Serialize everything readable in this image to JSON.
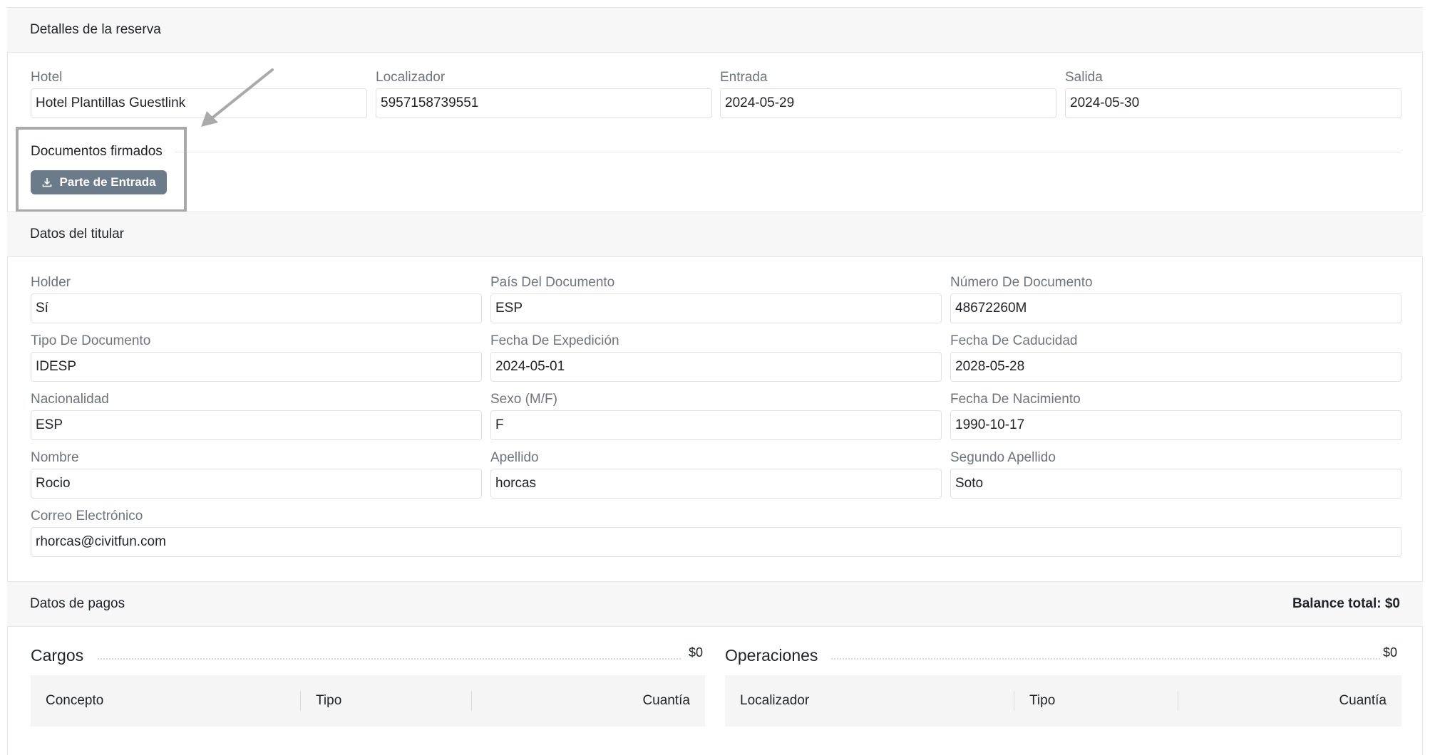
{
  "reservation": {
    "section_title": "Detalles de la reserva",
    "fields": [
      {
        "label": "Hotel",
        "value": "Hotel Plantillas Guestlink"
      },
      {
        "label": "Localizador",
        "value": "5957158739551"
      },
      {
        "label": "Entrada",
        "value": "2024-05-29"
      },
      {
        "label": "Salida",
        "value": "2024-05-30"
      }
    ],
    "signed_docs_label": "Documentos firmados",
    "download_button_label": "Parte de Entrada"
  },
  "holder": {
    "section_title": "Datos del titular",
    "fields": [
      {
        "label": "Holder",
        "value": "Sí"
      },
      {
        "label": "País Del Documento",
        "value": "ESP"
      },
      {
        "label": "Número De Documento",
        "value": "48672260M"
      },
      {
        "label": "Tipo De Documento",
        "value": "IDESP"
      },
      {
        "label": "Fecha De Expedición",
        "value": "2024-05-01"
      },
      {
        "label": "Fecha De Caducidad",
        "value": "2028-05-28"
      },
      {
        "label": "Nacionalidad",
        "value": "ESP"
      },
      {
        "label": "Sexo (M/F)",
        "value": "F"
      },
      {
        "label": "Fecha De Nacimiento",
        "value": "1990-10-17"
      },
      {
        "label": "Nombre",
        "value": "Rocio"
      },
      {
        "label": "Apellido",
        "value": "horcas"
      },
      {
        "label": "Segundo Apellido",
        "value": "Soto"
      },
      {
        "label": "Correo Electrónico",
        "value": "rhorcas@civitfun.com"
      }
    ]
  },
  "payments": {
    "section_title": "Datos de pagos",
    "balance_total": "Balance total: $0",
    "charges": {
      "title": "Cargos",
      "amount": "$0",
      "columns": [
        "Concepto",
        "Tipo",
        "Cuantía"
      ]
    },
    "operations": {
      "title": "Operaciones",
      "amount": "$0",
      "columns": [
        "Localizador",
        "Tipo",
        "Cuantía"
      ]
    }
  },
  "colors": {
    "button_bg": "#6c7b8a",
    "highlight_border": "#a9a9a9",
    "section_bg": "#f7f7f7"
  },
  "icons": {
    "download": "download-icon",
    "annotation_arrow": "arrow-icon"
  }
}
